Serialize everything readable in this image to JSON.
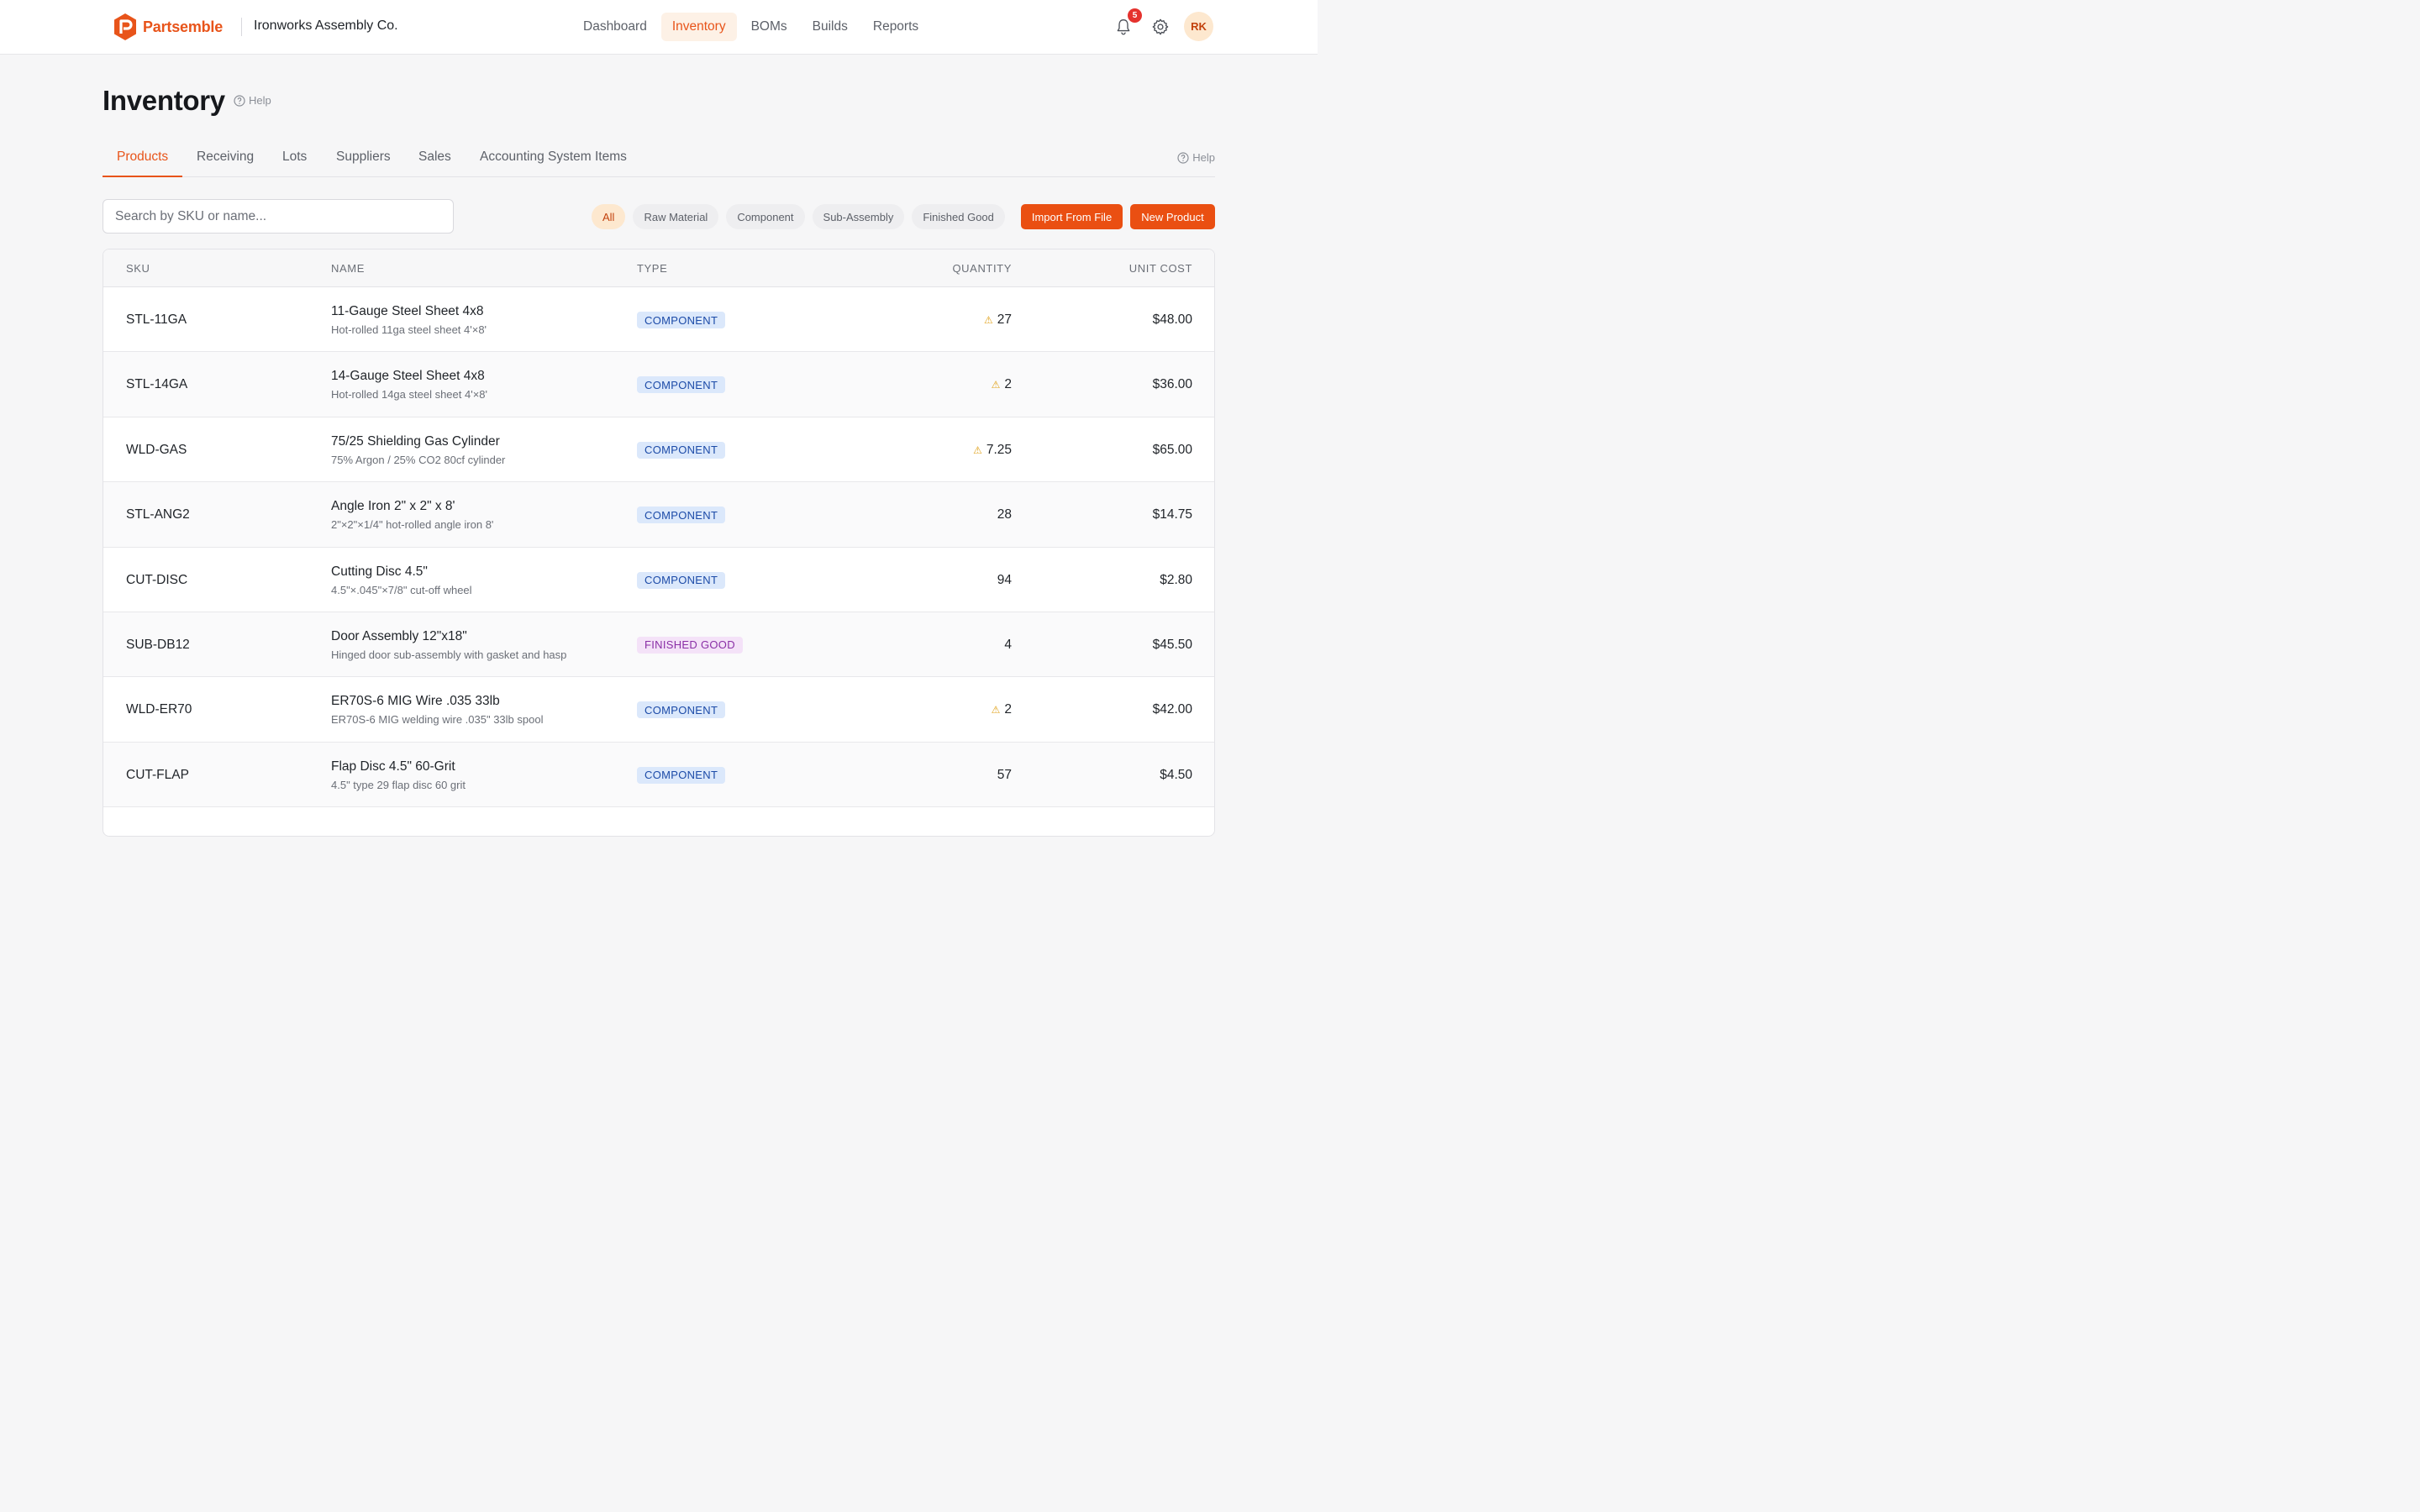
{
  "brand": {
    "name": "Partsemble",
    "org": "Ironworks Assembly Co.",
    "accent": "#e8541a"
  },
  "nav": [
    {
      "label": "Dashboard",
      "active": false
    },
    {
      "label": "Inventory",
      "active": true
    },
    {
      "label": "BOMs",
      "active": false
    },
    {
      "label": "Builds",
      "active": false
    },
    {
      "label": "Reports",
      "active": false
    }
  ],
  "header": {
    "notifications": "5",
    "avatar_initials": "RK"
  },
  "page": {
    "title": "Inventory",
    "help": "Help"
  },
  "tabs": {
    "items": [
      "Products",
      "Receiving",
      "Lots",
      "Suppliers",
      "Sales",
      "Accounting System Items"
    ],
    "active": "Products",
    "help": "Help"
  },
  "search": {
    "placeholder": "Search by SKU or name...",
    "value": ""
  },
  "filters": [
    "All",
    "Raw Material",
    "Component",
    "Sub-Assembly",
    "Finished Good"
  ],
  "actions": {
    "import": "Import From File",
    "new": "New Product"
  },
  "table": {
    "columns": [
      "SKU",
      "NAME",
      "TYPE",
      "QUANTITY",
      "UNIT COST"
    ],
    "rows": [
      {
        "sku": "STL-11GA",
        "name": "11-Gauge Steel Sheet 4x8",
        "desc": "Hot-rolled 11ga steel sheet 4'×8'",
        "type": "COMPONENT",
        "qty": "27",
        "low": true,
        "cost": "$48.00"
      },
      {
        "sku": "STL-14GA",
        "name": "14-Gauge Steel Sheet 4x8",
        "desc": "Hot-rolled 14ga steel sheet 4'×8'",
        "type": "COMPONENT",
        "qty": "2",
        "low": true,
        "cost": "$36.00"
      },
      {
        "sku": "WLD-GAS",
        "name": "75/25 Shielding Gas Cylinder",
        "desc": "75% Argon / 25% CO2 80cf cylinder",
        "type": "COMPONENT",
        "qty": "7.25",
        "low": true,
        "cost": "$65.00"
      },
      {
        "sku": "STL-ANG2",
        "name": "Angle Iron 2\" x 2\" x 8'",
        "desc": "2\"×2\"×1/4\" hot-rolled angle iron 8'",
        "type": "COMPONENT",
        "qty": "28",
        "low": false,
        "cost": "$14.75"
      },
      {
        "sku": "CUT-DISC",
        "name": "Cutting Disc 4.5\"",
        "desc": "4.5\"×.045\"×7/8\" cut-off wheel",
        "type": "COMPONENT",
        "qty": "94",
        "low": false,
        "cost": "$2.80"
      },
      {
        "sku": "SUB-DB12",
        "name": "Door Assembly 12\"x18\"",
        "desc": "Hinged door sub-assembly with gasket and hasp",
        "type": "FINISHED GOOD",
        "qty": "4",
        "low": false,
        "cost": "$45.50"
      },
      {
        "sku": "WLD-ER70",
        "name": "ER70S-6 MIG Wire .035 33lb",
        "desc": "ER70S-6 MIG welding wire .035\" 33lb spool",
        "type": "COMPONENT",
        "qty": "2",
        "low": true,
        "cost": "$42.00"
      },
      {
        "sku": "CUT-FLAP",
        "name": "Flap Disc 4.5\" 60-Grit",
        "desc": "4.5\" type 29 flap disc 60 grit",
        "type": "COMPONENT",
        "qty": "57",
        "low": false,
        "cost": "$4.50"
      }
    ]
  }
}
